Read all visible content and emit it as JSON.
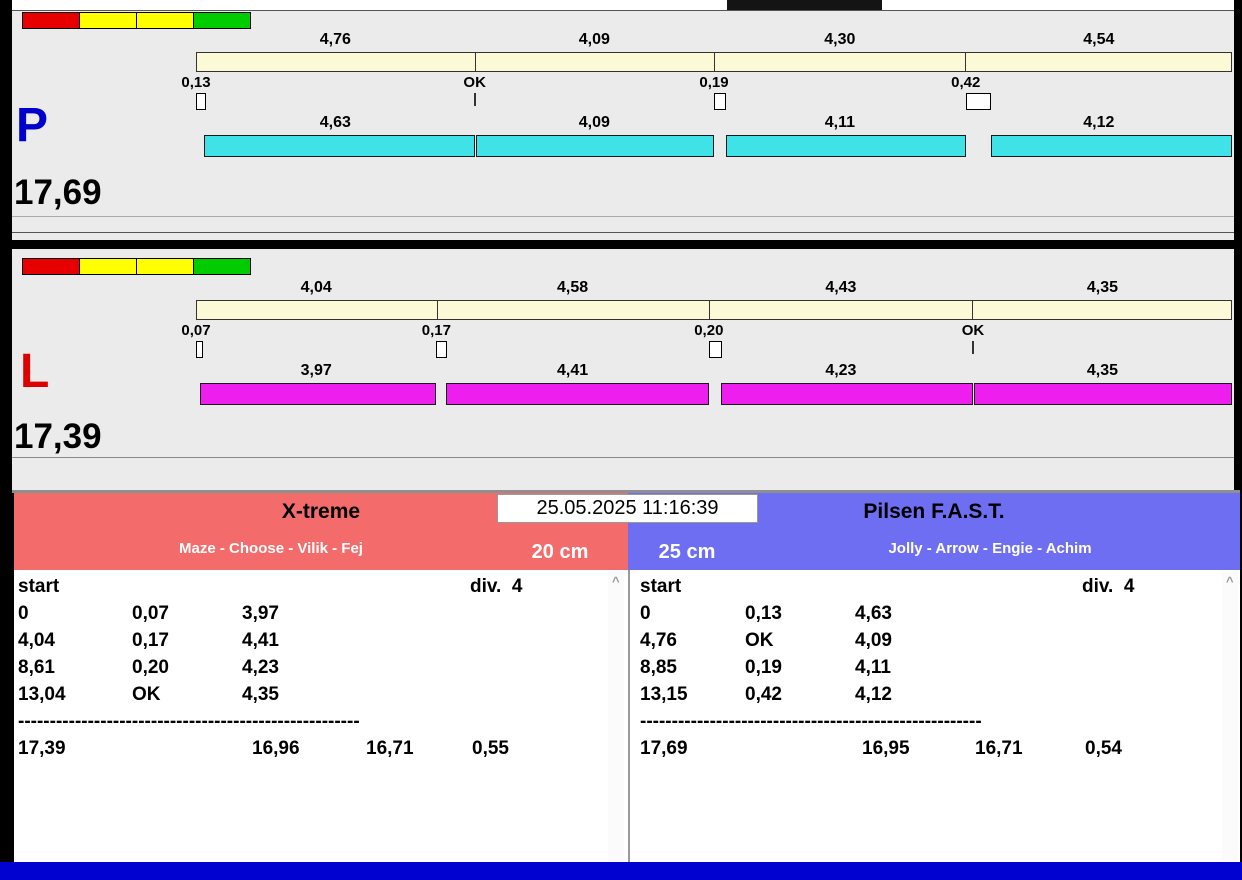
{
  "colors": {
    "status": [
      "#e60000",
      "#ffff00",
      "#ffff00",
      "#00cc00"
    ],
    "p_bar": "#3fe2e6",
    "l_bar": "#ee1fee",
    "lane_bar": "#fbf9d6",
    "left_header": "#f46b6b",
    "right_header": "#6e6ef2",
    "bottom_strip": "#0101d0",
    "letter_p": "#0000cc",
    "letter_l": "#dd0000"
  },
  "sections": {
    "p": {
      "letter": "P",
      "total": "17,69",
      "lane_values": [
        "4,76",
        "4,09",
        "4,30",
        "4,54"
      ],
      "offsets": [
        "0,13",
        "OK",
        "0,19",
        "0,42"
      ],
      "run_values": [
        "4,63",
        "4,09",
        "4,11",
        "4,12"
      ]
    },
    "l": {
      "letter": "L",
      "total": "17,39",
      "lane_values": [
        "4,04",
        "4,58",
        "4,43",
        "4,35"
      ],
      "offsets": [
        "0,07",
        "0,17",
        "0,20",
        "OK"
      ],
      "run_values": [
        "3,97",
        "4,41",
        "4,23",
        "4,35"
      ]
    }
  },
  "footer": {
    "datetime": "25.05.2025 11:16:39",
    "left": {
      "team": "X-treme",
      "players": "Maze - Choose - Vilik - Fej",
      "distance": "20 cm",
      "start_label": "start",
      "div_label": "div.  4",
      "rows": [
        [
          "0",
          "0,07",
          "3,97"
        ],
        [
          "4,04",
          "0,17",
          "4,41"
        ],
        [
          "8,61",
          "0,20",
          "4,23"
        ],
        [
          "13,04",
          "OK",
          "4,35"
        ]
      ],
      "dashes": "------------------------------------------------------",
      "totals": [
        "17,39",
        "16,96",
        "16,71",
        "0,55"
      ]
    },
    "right": {
      "team": "Pilsen F.A.S.T.",
      "players": "Jolly - Arrow - Engie - Achim",
      "distance": "25 cm",
      "start_label": "start",
      "div_label": "div.  4",
      "rows": [
        [
          "0",
          "0,13",
          "4,63"
        ],
        [
          "4,76",
          "OK",
          "4,09"
        ],
        [
          "8,85",
          "0,19",
          "4,11"
        ],
        [
          "13,15",
          "0,42",
          "4,12"
        ]
      ],
      "dashes": "------------------------------------------------------",
      "totals": [
        "17,69",
        "16,95",
        "16,71",
        "0,54"
      ]
    }
  },
  "icons": {
    "scroll_up": "^"
  }
}
